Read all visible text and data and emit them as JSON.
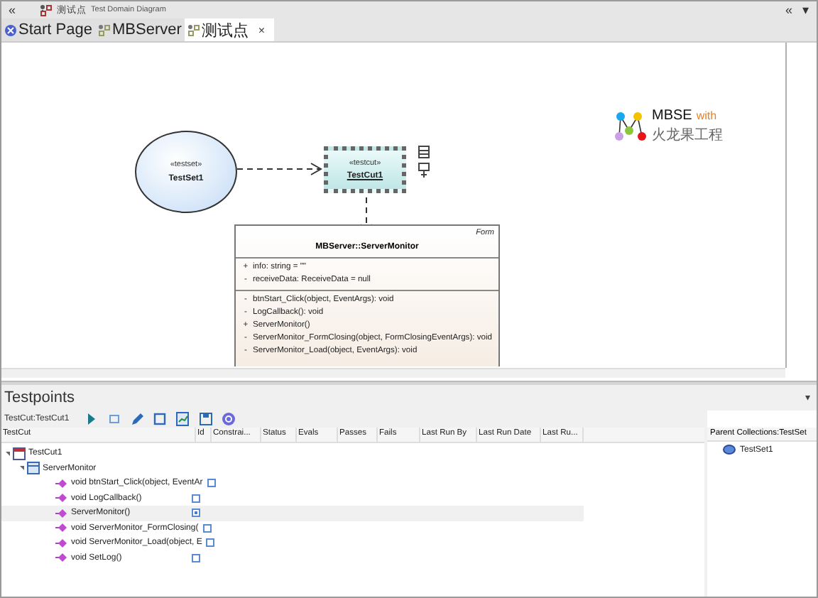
{
  "title_bar": {
    "left_glyph": "«",
    "title": "测试点",
    "subtitle": "Test Domain Diagram",
    "right_glyphs": [
      "«",
      "▾"
    ]
  },
  "tabs": [
    {
      "label": "Start Page",
      "kind": "start",
      "selected": false
    },
    {
      "label": "MBServer",
      "kind": "diagram",
      "selected": false
    },
    {
      "label": "测试点",
      "kind": "diagram",
      "selected": true,
      "close": "×"
    }
  ],
  "diagram": {
    "testset": {
      "stereotype": "«testset»",
      "name": "TestSet1"
    },
    "testcut": {
      "stereotype": "«testcut»",
      "name": "TestCut1",
      "selected": true
    },
    "class": {
      "stereotype": "Form",
      "name": "MBServer::ServerMonitor",
      "attributes": [
        {
          "visibility": "+",
          "text": "info: string = \"\""
        },
        {
          "visibility": "-",
          "text": "receiveData: ReceiveData = null"
        }
      ],
      "operations": [
        {
          "visibility": "-",
          "text": "btnStart_Click(object, EventArgs): void"
        },
        {
          "visibility": "-",
          "text": "LogCallback(): void"
        },
        {
          "visibility": "+",
          "text": "ServerMonitor()"
        },
        {
          "visibility": "-",
          "text": "ServerMonitor_FormClosing(object, FormClosingEventArgs): void"
        },
        {
          "visibility": "-",
          "text": "ServerMonitor_Load(object, EventArgs): void"
        }
      ]
    },
    "logo": {
      "title": "MBSE",
      "accent": "with",
      "subtitle": "火龙果工程"
    }
  },
  "testpoints": {
    "title": "Testpoints",
    "menu_glyph": "▾",
    "context": "TestCut:TestCut1",
    "columns": [
      "TestCut",
      "Id",
      "Constrai...",
      "Status",
      "Evals",
      "Passes",
      "Fails",
      "Last Run By",
      "Last Run Date",
      "Last Ru..."
    ],
    "tree": [
      {
        "name": "TestCut1",
        "kind": "testcut",
        "expanded": true,
        "children": [
          {
            "name": "ServerMonitor",
            "kind": "class",
            "expanded": true,
            "children": [
              {
                "name": "void btnStart_Click(object, EventAr",
                "kind": "operation",
                "checked": false,
                "selected": false
              },
              {
                "name": "void LogCallback()",
                "kind": "operation",
                "checked": false,
                "selected": false
              },
              {
                "name": "ServerMonitor()",
                "kind": "operation",
                "checked": true,
                "selected": true
              },
              {
                "name": "void ServerMonitor_FormClosing(",
                "kind": "operation",
                "checked": false,
                "selected": false
              },
              {
                "name": "void ServerMonitor_Load(object, E",
                "kind": "operation",
                "checked": false,
                "selected": false
              },
              {
                "name": "void SetLog()",
                "kind": "operation",
                "checked": false,
                "selected": false
              }
            ]
          }
        ]
      }
    ],
    "parent_panel": {
      "title": "Parent Collections:TestSet",
      "items": [
        "TestSet1"
      ]
    }
  }
}
